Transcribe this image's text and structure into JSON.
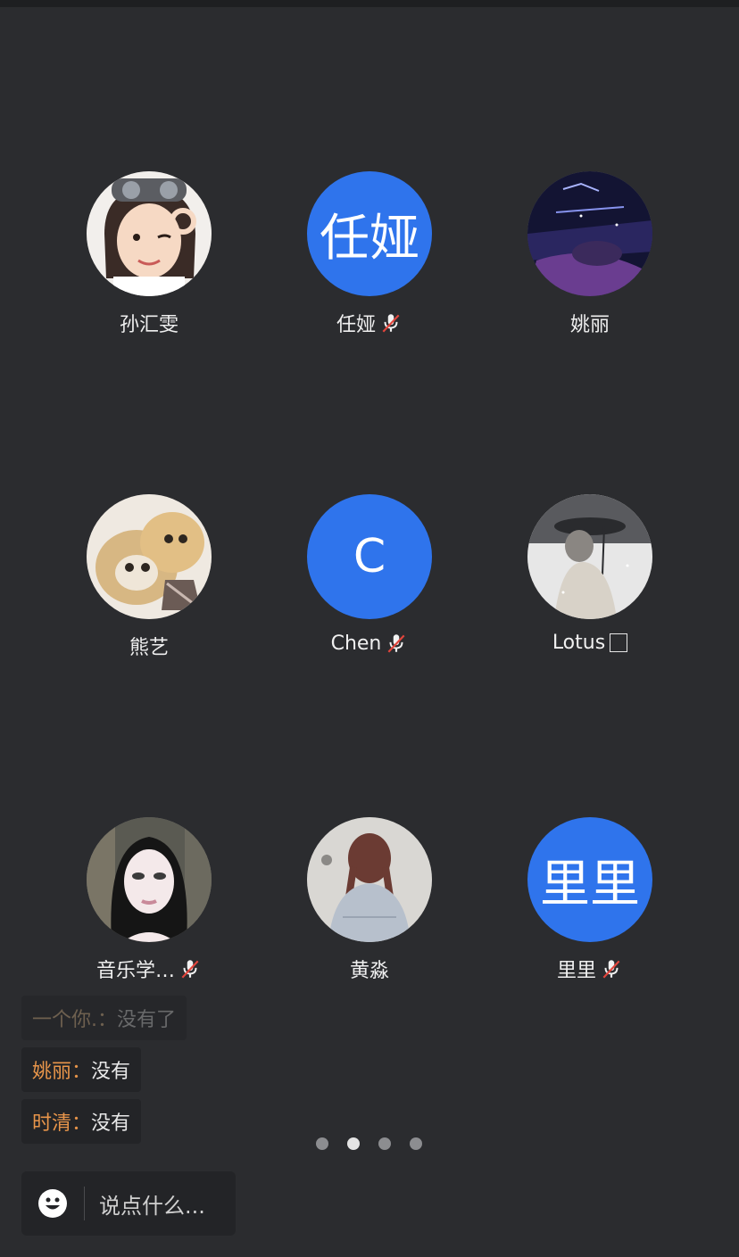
{
  "participants": [
    {
      "name": "孙汇雯",
      "avatar_type": "photo",
      "muted": false
    },
    {
      "name": "任娅",
      "avatar_type": "letter",
      "avatar_text": "任娅",
      "muted": true
    },
    {
      "name": "姚丽",
      "avatar_type": "photo",
      "muted": false
    },
    {
      "name": "熊艺",
      "avatar_type": "photo",
      "muted": false
    },
    {
      "name": "Chen",
      "avatar_type": "letter",
      "avatar_text": "C",
      "muted": true
    },
    {
      "name": "Lotus",
      "avatar_type": "photo",
      "muted": false,
      "trailing_glyph": "□"
    },
    {
      "name": "音乐学…",
      "avatar_type": "photo",
      "muted": true
    },
    {
      "name": "黄淼",
      "avatar_type": "photo",
      "muted": false
    },
    {
      "name": "里里",
      "avatar_type": "letter",
      "avatar_text": "里里",
      "muted": true
    }
  ],
  "chat": [
    {
      "sender": "一个你.",
      "separator": "：",
      "text": "没有了"
    },
    {
      "sender": "姚丽",
      "separator": "：",
      "text": "没有"
    },
    {
      "sender": "时清",
      "separator": "：",
      "text": "没有"
    }
  ],
  "pager": {
    "total": 4,
    "active_index": 1
  },
  "input": {
    "placeholder": "说点什么..."
  },
  "colors": {
    "background": "#2b2c2f",
    "avatar_blue": "#2f74ec",
    "sender_orange": "#e8954a",
    "mute_red": "#e2453c"
  },
  "icons": {
    "muted": "mic-off-icon",
    "emoji": "smiley-icon"
  }
}
